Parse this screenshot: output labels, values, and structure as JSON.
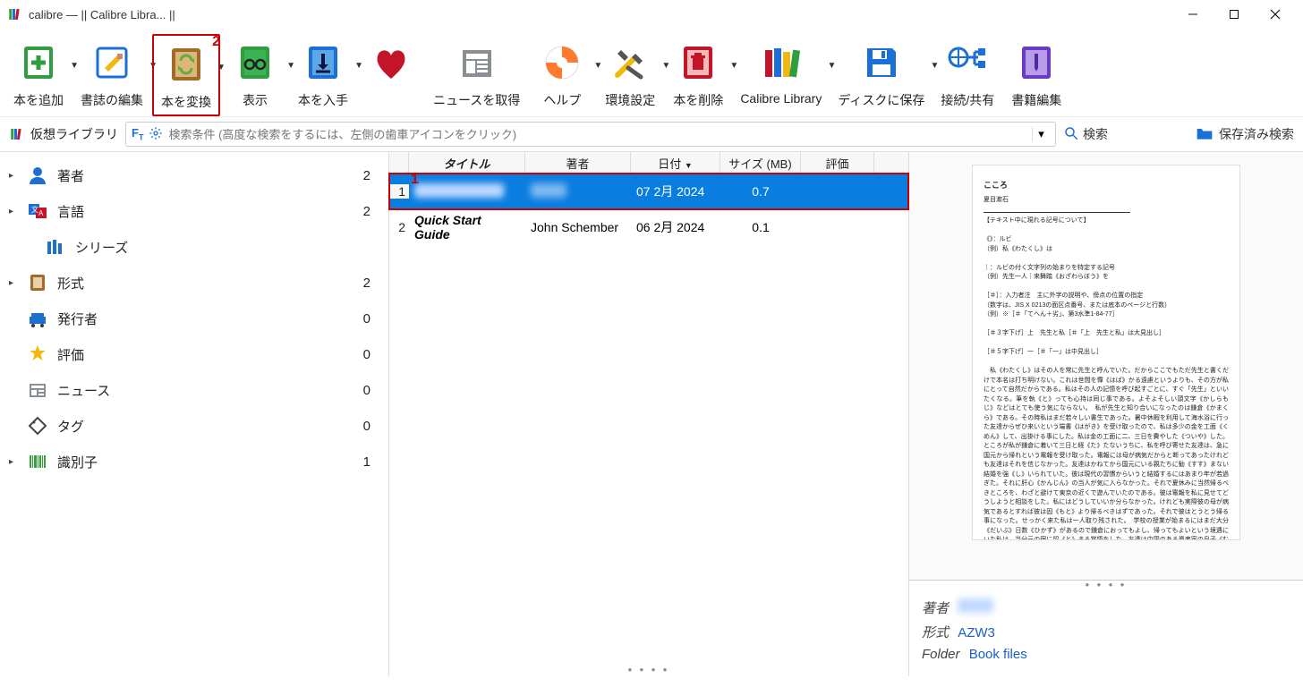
{
  "window": {
    "title": "calibre — || Calibre Libra... ||"
  },
  "toolbar": [
    {
      "id": "add",
      "label": "本を追加",
      "dd": true,
      "color": "#2e9e3f"
    },
    {
      "id": "editmeta",
      "label": "書誌の編集",
      "dd": true,
      "color": "#1b6fd6"
    },
    {
      "id": "convert",
      "label": "本を変換",
      "dd": true,
      "color": "#a36b28",
      "highlight": true,
      "mark": "2"
    },
    {
      "id": "view",
      "label": "表示",
      "dd": true,
      "color": "#2e9e3f"
    },
    {
      "id": "fetch",
      "label": "本を入手",
      "dd": true,
      "color": "#1b6fd6"
    },
    {
      "id": "heart",
      "label": "",
      "dd": false,
      "color": "#c3152a"
    },
    {
      "id": "news",
      "label": "ニュースを取得",
      "dd": false,
      "color": "#8a8f94"
    },
    {
      "id": "help",
      "label": "ヘルプ",
      "dd": true,
      "color": "#ff7a2e"
    },
    {
      "id": "prefs",
      "label": "環境設定",
      "dd": true,
      "color": "#8a7a3a"
    },
    {
      "id": "remove",
      "label": "本を削除",
      "dd": true,
      "color": "#c3152a"
    },
    {
      "id": "library",
      "label": "Calibre Library",
      "dd": true,
      "color": "#7a4d1e"
    },
    {
      "id": "save",
      "label": "ディスクに保存",
      "dd": true,
      "color": "#1b6fd6"
    },
    {
      "id": "connect",
      "label": "接続/共有",
      "dd": false,
      "color": "#1b6fd6"
    },
    {
      "id": "editbook",
      "label": "書籍編集",
      "dd": false,
      "color": "#6a3bc6"
    }
  ],
  "subbar": {
    "vlib": "仮想ライブラリ",
    "search_placeholder": "検索条件 (高度な検索をするには、左側の歯車アイコンをクリック)",
    "go": "検索",
    "saved": "保存済み検索"
  },
  "sidebar": [
    {
      "icon": "author",
      "label": "著者",
      "count": "2",
      "expand": true,
      "color": "#1f6fd0"
    },
    {
      "icon": "lang",
      "label": "言語",
      "count": "2",
      "expand": true,
      "color": "#1f6fd0"
    },
    {
      "icon": "series",
      "label": "シリーズ",
      "count": "",
      "expand": false,
      "color": "#1f6fd0",
      "indent": true
    },
    {
      "icon": "format",
      "label": "形式",
      "count": "2",
      "expand": true,
      "color": "#a36b28"
    },
    {
      "icon": "publisher",
      "label": "発行者",
      "count": "0",
      "expand": false,
      "color": "#1f6fd0"
    },
    {
      "icon": "rating",
      "label": "評価",
      "count": "0",
      "expand": false,
      "color": "#f2b90c"
    },
    {
      "icon": "news",
      "label": "ニュース",
      "count": "0",
      "expand": false,
      "color": "#8a8f94"
    },
    {
      "icon": "tag",
      "label": "タグ",
      "count": "0",
      "expand": false,
      "color": "#444"
    },
    {
      "icon": "ident",
      "label": "識別子",
      "count": "1",
      "expand": true,
      "color": "#35a13a"
    }
  ],
  "table": {
    "headers": {
      "title": "タイトル",
      "author": "著者",
      "date": "日付",
      "size": "サイズ (MB)",
      "rating": "評価"
    },
    "rows": [
      {
        "n": "1",
        "title": "",
        "author": "",
        "date": "07 2月 2024",
        "size": "0.7",
        "rating": "",
        "selected": true,
        "redacted": true
      },
      {
        "n": "2",
        "title": "Quick Start Guide",
        "author": "John Schember",
        "date": "06 2月 2024",
        "size": "0.1",
        "rating": ""
      }
    ]
  },
  "metadata": {
    "author_label": "著者",
    "format_label": "形式",
    "format": "AZW3",
    "folder_label": "Folder",
    "folder": "Book files"
  },
  "preview": {
    "heading": "こころ",
    "sub": "夏目漱石",
    "note1": "【テキスト中に現れる記号について】",
    "note2": "《》：ルビ",
    "note3": "（例）私《わたくし》は",
    "note4": "｜：ルビの付く文字列の始まりを特定する記号",
    "note5": "（例）先生一人｜来舞踏《おざわらぼう》を",
    "note6": "［＃］：入力者注　主に外字の説明や、傍点の位置の指定",
    "note7": "（数字は、JIS X 0213の面区点番号、または底本のページと行数）",
    "note8": "（例）※［＃「てへん＋劣」、第3水準1-84-77］",
    "note9": "［＃３字下げ］上　先生と私［＃「上　先生と私」は大見出し］",
    "note10": "［＃５字下げ］一［＃「一」は中見出し］",
    "body": "　私《わたくし》はその人を常に先生と呼んでいた。だからここでもただ先生と書くだけで本名は打ち明けない。これは世間を憚《はば》かる遠慮というよりも、その方が私にとって自然だからである。私はその人の記憶を呼び起すごとに、すぐ「先生」といいたくなる。筆を執《と》っても心持は同じ事である。よそよそしい頭文字《かしらもじ》などはとても使う気にならない。　私が先生と知り合いになったのは鎌倉《かまくら》である。その時私はまだ若々しい書生であった。暑中休暇を利用して海水浴に行った友達からぜひ来いという端書《はがき》を受け取ったので、私は多少の金を工面《くめん》して、出掛ける事にした。私は金の工面に二、三日を費やした《ついや》した。ところが私が鎌倉に着いて三日と経《た》たないうちに、私を呼び寄せた友達は、急に国元から帰れという電報を受け取った。電報には母が病気だからと断ってあったけれども友達はそれを信じなかった。友達はかねてから国元にいる親たちに勧《すす》まない結婚を強《し》いられていた。彼は現代の習慣からいうと結婚するにはあまり年が若過ぎた。それに肝心《かんじん》の当人が気に入らなかった。それで夏休みに当然帰るべきところを、わざと避けて東京の近くで遊んでいたのである。彼は電報を私に見せてどうしようと相談をした。私にはどうしていいか分らなかった。けれども実際彼の母が病気であるとすれば彼は固《もと》より帰るべきはずであった。それで彼はとうとう帰る事になった。せっかく来た私は一人取り残された。　学校の授業が始まるにはまだ大分《だいぶ》日数《ひかず》があるので鎌倉におってもよし、帰ってもよいという境遇にいた私は、当分元の宿に留《と》まる覚悟をした。友達は中国のある資産家の息子《むすこ》で金に不自由のない男であったけれども、学校が…"
  }
}
